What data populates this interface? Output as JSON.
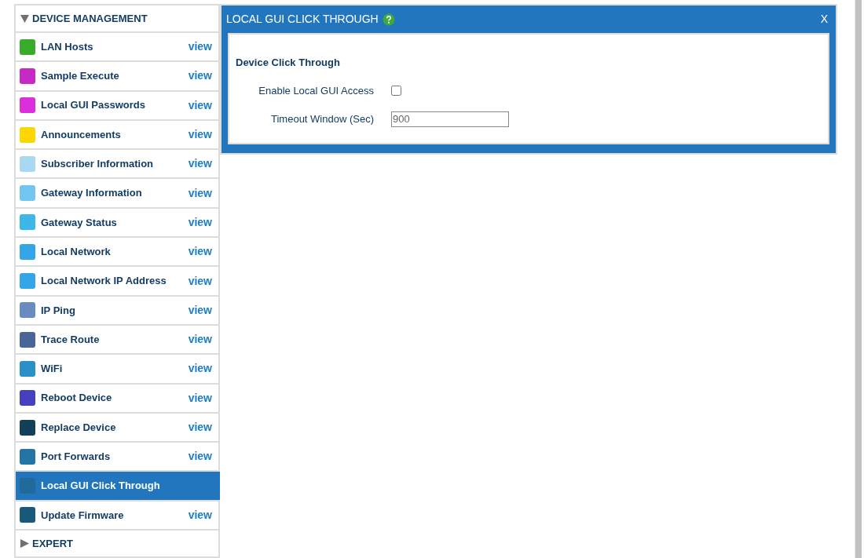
{
  "sidebar": {
    "sections": [
      {
        "title": "DEVICE MANAGEMENT",
        "expanded": true,
        "items": [
          {
            "label": "LAN Hosts",
            "color": "#3aaa2a",
            "link": "view",
            "selected": false
          },
          {
            "label": "Sample Execute",
            "color": "#c72ac4",
            "link": "view",
            "selected": false
          },
          {
            "label": "Local GUI Passwords",
            "color": "#dc2fdc",
            "link": "view",
            "selected": false
          },
          {
            "label": "Announcements",
            "color": "#fed700",
            "link": "view",
            "selected": false
          },
          {
            "label": "Subscriber Information",
            "color": "#a8d8f2",
            "link": "view",
            "selected": false
          },
          {
            "label": "Gateway Information",
            "color": "#72c6ef",
            "link": "view",
            "selected": false
          },
          {
            "label": "Gateway Status",
            "color": "#3db7ea",
            "link": "view",
            "selected": false
          },
          {
            "label": "Local Network",
            "color": "#34a5e6",
            "link": "view",
            "selected": false
          },
          {
            "label": "Local Network IP Address",
            "color": "#34a5e6",
            "link": "view",
            "selected": false
          },
          {
            "label": "IP Ping",
            "color": "#6a8bc0",
            "link": "view",
            "selected": false
          },
          {
            "label": "Trace Route",
            "color": "#4a6699",
            "link": "view",
            "selected": false
          },
          {
            "label": "WiFi",
            "color": "#2a90c8",
            "link": "view",
            "selected": false
          },
          {
            "label": "Reboot Device",
            "color": "#4440c0",
            "link": "view",
            "selected": false
          },
          {
            "label": "Replace Device",
            "color": "#123f5a",
            "link": "view",
            "selected": false
          },
          {
            "label": "Port Forwards",
            "color": "#2474a4",
            "link": "view",
            "selected": false
          },
          {
            "label": "Local GUI Click Through",
            "color": "#216a9a",
            "selected": true
          },
          {
            "label": "Update Firmware",
            "color": "#185878",
            "link": "view",
            "selected": false
          }
        ]
      },
      {
        "title": "EXPERT",
        "expanded": false
      }
    ]
  },
  "panel": {
    "title": "LOCAL GUI CLICK THROUGH",
    "close": "X",
    "section_title": "Device Click Through",
    "fields": [
      {
        "kind": "checkbox",
        "label": "Enable Local GUI Access",
        "checked": false
      },
      {
        "kind": "text",
        "label": "Timeout Window (Sec)",
        "value": "900"
      }
    ]
  }
}
